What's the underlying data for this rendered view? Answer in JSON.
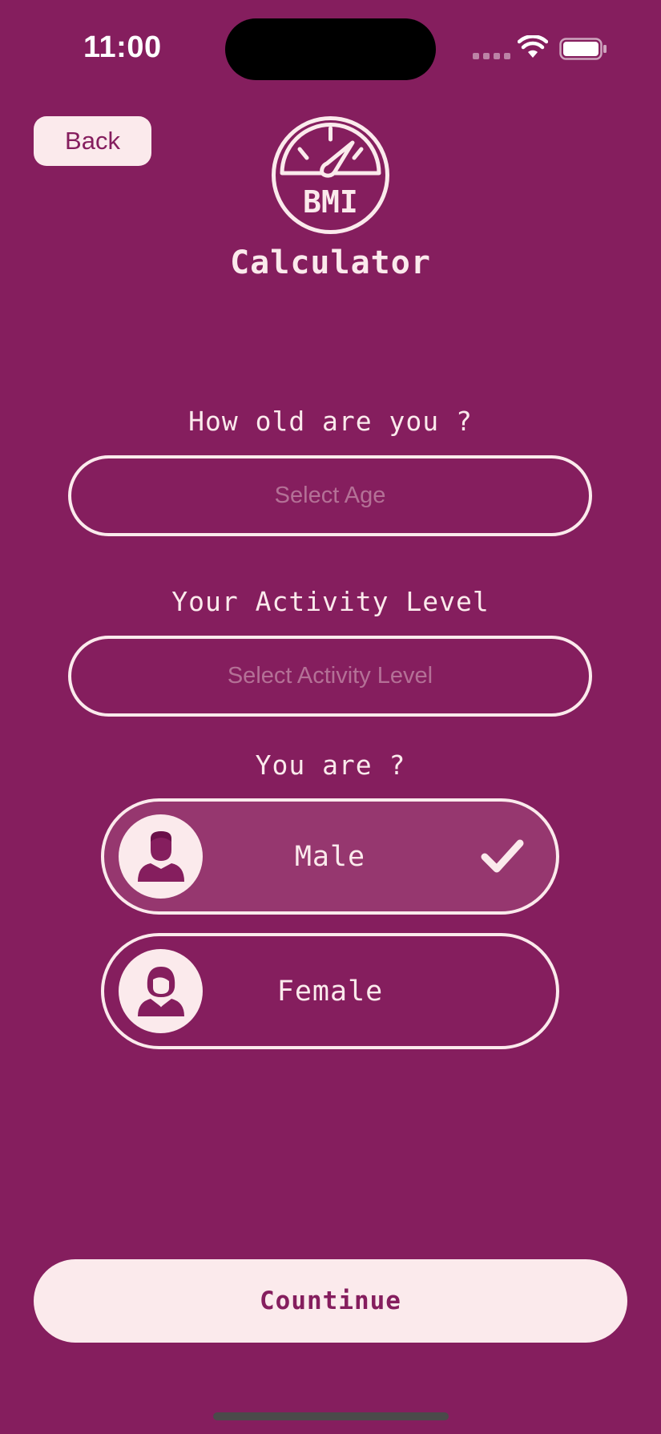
{
  "status_bar": {
    "time": "11:00"
  },
  "nav": {
    "back_label": "Back"
  },
  "logo": {
    "text": "BMI"
  },
  "app_title": "Calculator",
  "age": {
    "label": "How old are you ?",
    "placeholder": "Select Age"
  },
  "activity": {
    "label": "Your Activity Level",
    "placeholder": "Select Activity Level"
  },
  "gender": {
    "label": "You are ?",
    "options": [
      {
        "label": "Male",
        "selected": true,
        "icon": "male-avatar-icon"
      },
      {
        "label": "Female",
        "selected": false,
        "icon": "female-avatar-icon"
      }
    ]
  },
  "continue_label": "Countinue",
  "colors": {
    "background": "#851e5e",
    "foreground": "#fbeaec",
    "selected": "#96376f"
  }
}
